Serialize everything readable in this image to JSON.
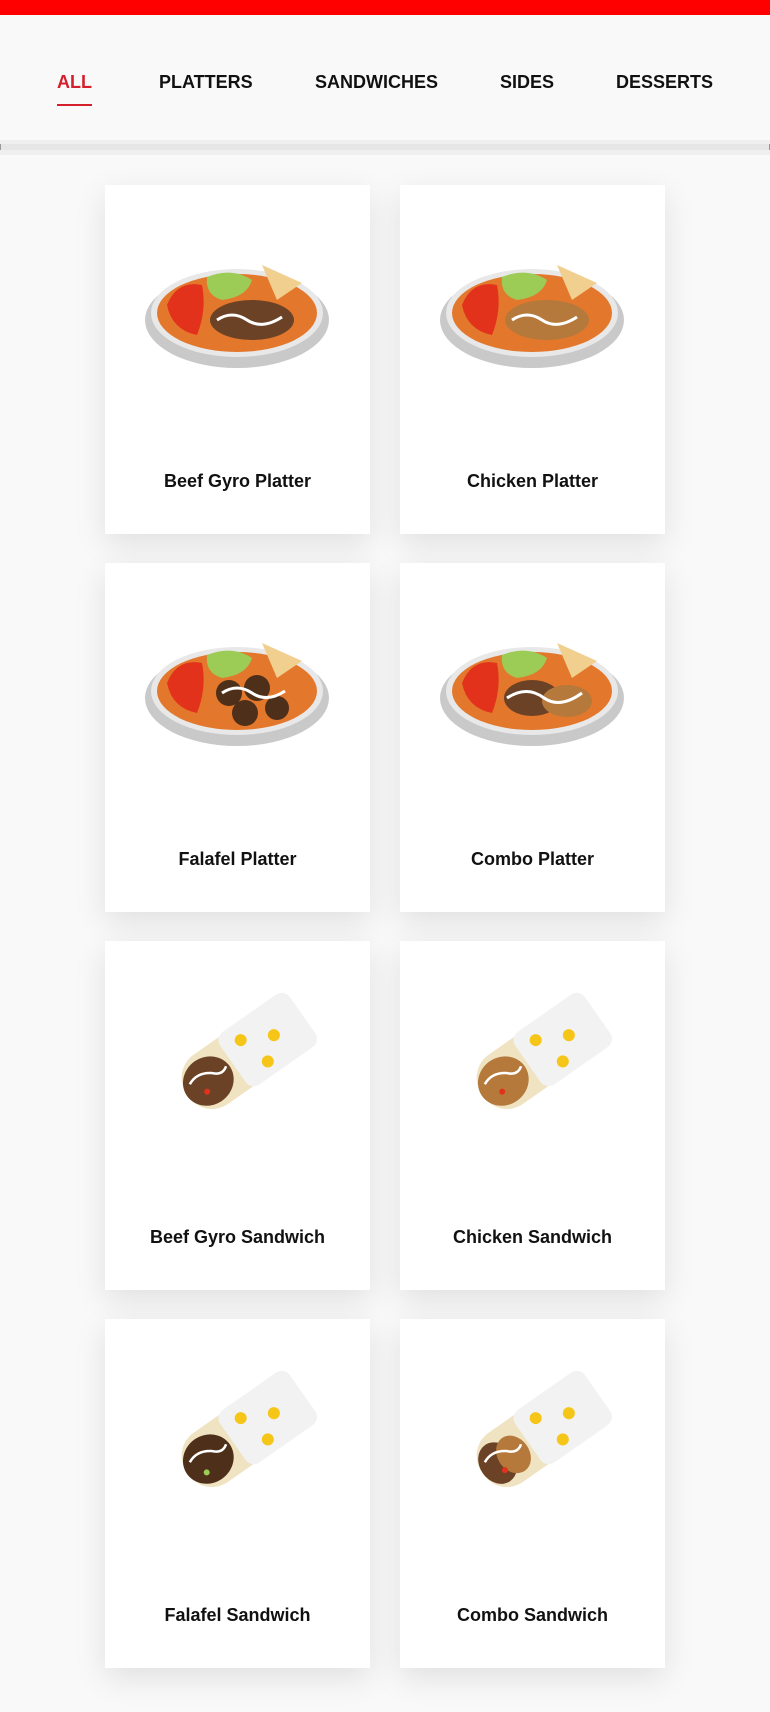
{
  "tabs": [
    {
      "label": "ALL",
      "active": true
    },
    {
      "label": "PLATTERS",
      "active": false
    },
    {
      "label": "SANDWICHES",
      "active": false
    },
    {
      "label": "SIDES",
      "active": false
    },
    {
      "label": "DESSERTS",
      "active": false
    }
  ],
  "accent_color": "#d4202c",
  "menu_items": [
    {
      "name": "Beef Gyro Platter",
      "image": "platter-beef-icon"
    },
    {
      "name": "Chicken Platter",
      "image": "platter-chicken-icon"
    },
    {
      "name": "Falafel Platter",
      "image": "platter-falafel-icon"
    },
    {
      "name": "Combo Platter",
      "image": "platter-combo-icon"
    },
    {
      "name": "Beef Gyro Sandwich",
      "image": "sandwich-beef-icon"
    },
    {
      "name": "Chicken Sandwich",
      "image": "sandwich-chicken-icon"
    },
    {
      "name": "Falafel Sandwich",
      "image": "sandwich-falafel-icon"
    },
    {
      "name": "Combo Sandwich",
      "image": "sandwich-combo-icon"
    }
  ]
}
